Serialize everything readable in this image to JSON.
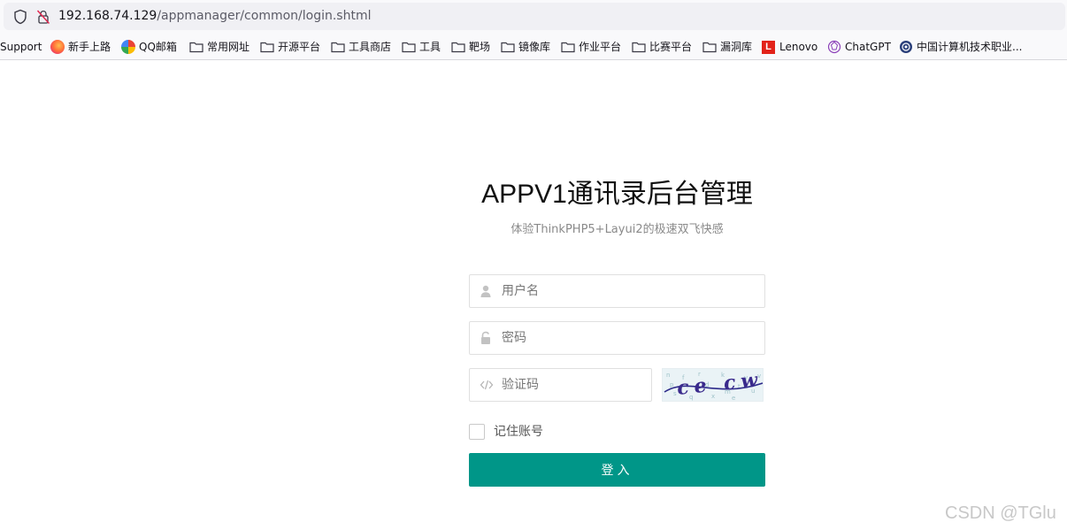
{
  "browser": {
    "url_host": "192.168.74.129",
    "url_path": "/appmanager/common/login.shtml",
    "bookmarks": [
      {
        "label": "Support",
        "icon": "none"
      },
      {
        "label": "新手上路",
        "icon": "firefox-icon"
      },
      {
        "label": "QQ邮箱",
        "icon": "qqmail-icon"
      },
      {
        "label": "常用网址",
        "icon": "folder-icon"
      },
      {
        "label": "开源平台",
        "icon": "folder-icon"
      },
      {
        "label": "工具商店",
        "icon": "folder-icon"
      },
      {
        "label": "工具",
        "icon": "folder-icon"
      },
      {
        "label": "靶场",
        "icon": "folder-icon"
      },
      {
        "label": "镜像库",
        "icon": "folder-icon"
      },
      {
        "label": "作业平台",
        "icon": "folder-icon"
      },
      {
        "label": "比赛平台",
        "icon": "folder-icon"
      },
      {
        "label": "漏洞库",
        "icon": "folder-icon"
      },
      {
        "label": "Lenovo",
        "icon": "lenovo-icon"
      },
      {
        "label": "ChatGPT",
        "icon": "chatgpt-icon"
      },
      {
        "label": "中国计算机技术职业...",
        "icon": "site-icon"
      }
    ]
  },
  "login": {
    "title": "APPV1通讯录后台管理",
    "subtitle": "体验ThinkPHP5+Layui2的极速双飞快感",
    "username_placeholder": "用户名",
    "password_placeholder": "密码",
    "captcha_placeholder": "验证码",
    "captcha_text": "ce cw",
    "remember_label": "记住账号",
    "submit_label": "登入"
  },
  "watermark": "CSDN @TGlu",
  "colors": {
    "primary": "#009688",
    "border": "#e0e0e0",
    "captcha_bg": "#eaf3f6",
    "captcha_text": "#3a2a8c"
  }
}
